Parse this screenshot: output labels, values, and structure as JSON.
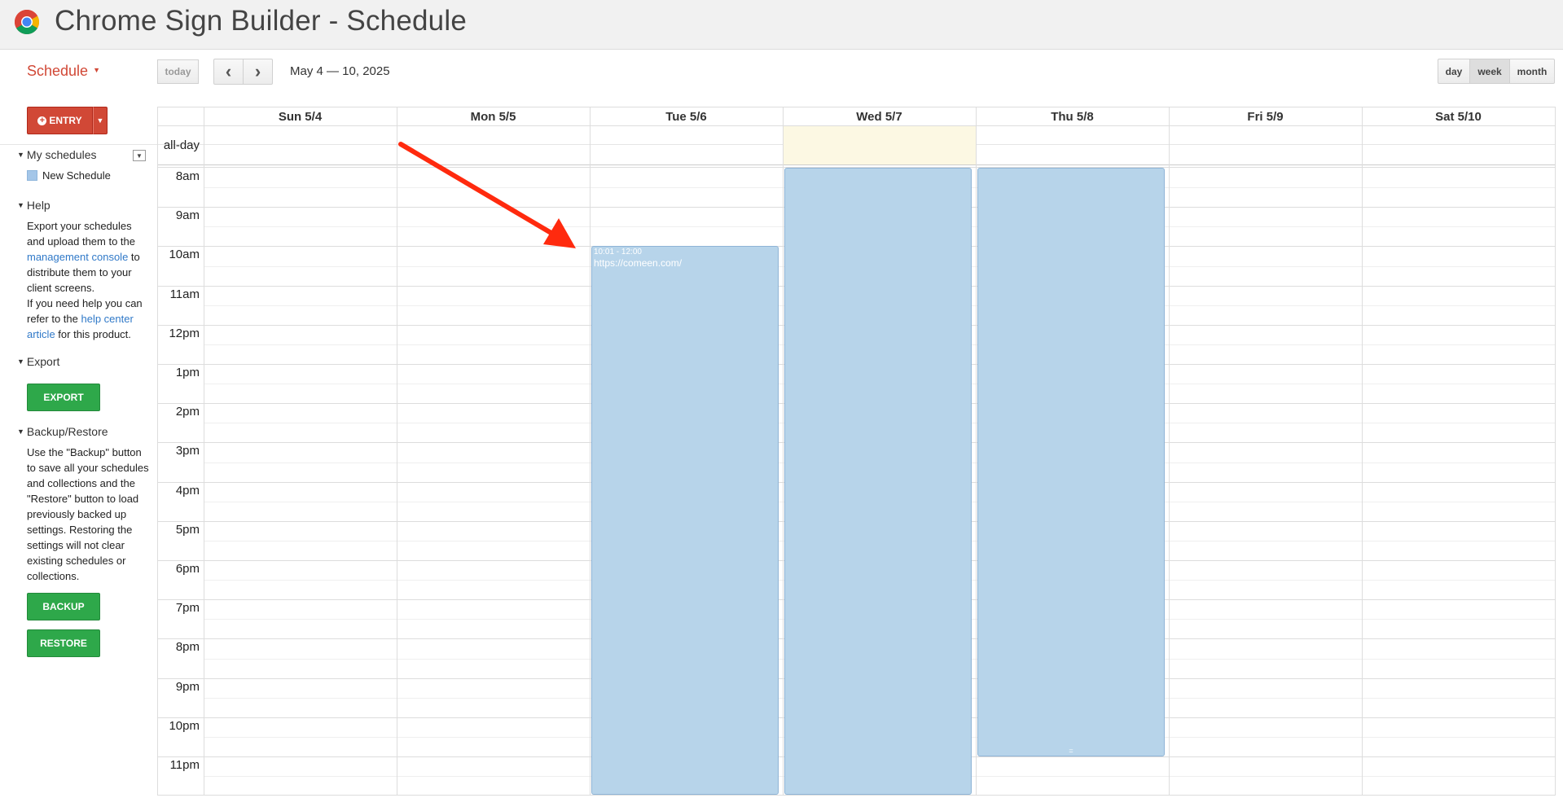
{
  "header": {
    "title": "Chrome Sign Builder - Schedule",
    "logo_icon": "chrome-logo-icon"
  },
  "toolbar": {
    "schedule_label": "Schedule",
    "today_label": "today",
    "prev_label": "‹",
    "next_label": "›",
    "date_range": "May 4 — 10, 2025",
    "views": {
      "day": "day",
      "week": "week",
      "month": "month"
    },
    "active_view": "week"
  },
  "sidebar": {
    "entry_label": "ENTRY",
    "my_schedules": {
      "title": "My schedules",
      "items": [
        {
          "label": "New Schedule",
          "color": "#a4c6e8"
        }
      ]
    },
    "help": {
      "title": "Help",
      "p1_a": "Export your schedules and upload them to the ",
      "p1_link": "management console",
      "p1_b": " to distribute them to your client screens.",
      "p2_a": "If you need help you can refer to the ",
      "p2_link": "help center article",
      "p2_b": " for this product."
    },
    "export": {
      "title": "Export",
      "button": "EXPORT"
    },
    "backup": {
      "title": "Backup/Restore",
      "text": "Use the \"Backup\" button to save all your schedules and collections and the \"Restore\" button to load previously backed up settings. Restoring the settings will not clear existing schedules or collections.",
      "backup_button": "BACKUP",
      "restore_button": "RESTORE"
    }
  },
  "calendar": {
    "days": [
      "Sun 5/4",
      "Mon 5/5",
      "Tue 5/6",
      "Wed 5/7",
      "Thu 5/8",
      "Fri 5/9",
      "Sat 5/10"
    ],
    "today_index": 3,
    "allday_label": "all-day",
    "hours": [
      "8am",
      "9am",
      "10am",
      "11am",
      "12pm",
      "1pm",
      "2pm",
      "3pm",
      "4pm",
      "5pm",
      "6pm",
      "7pm",
      "8pm",
      "9pm",
      "10pm",
      "11pm"
    ],
    "events": [
      {
        "day": 2,
        "start": 10.0,
        "end": 24,
        "time": "10:01 - 12:00",
        "title": "https://comeen.com/"
      },
      {
        "day": 3,
        "start": 8,
        "end": 24,
        "time": "",
        "title": ""
      },
      {
        "day": 4,
        "start": 8,
        "end": 23.0,
        "time": "",
        "title": "",
        "resize": "="
      }
    ]
  },
  "colors": {
    "accent_red": "#d14836",
    "green": "#2ea84a",
    "event_blue": "#b7d4ea",
    "today_bg": "#fcf8e3",
    "link": "#3079c8",
    "arrow": "#ff2a0e"
  }
}
